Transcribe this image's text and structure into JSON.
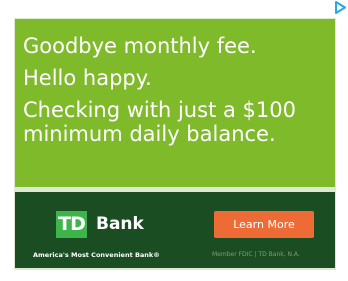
{
  "ad": {
    "headline_lines": [
      "Goodbye monthly fee.",
      "Hello happy.",
      "Checking with just a $100",
      "minimum daily balance."
    ],
    "logo_badge": "TD",
    "logo_name": "Bank",
    "tagline": "America's Most Convenient Bank®",
    "cta_label": "Learn More",
    "member_text": "Member FDIC | TD Bank, N.A.",
    "adchoices_icon": "adchoices-triangle-icon"
  },
  "colors": {
    "headline_bg": "#7fba2a",
    "footer_bg": "#1b4d23",
    "logo_green": "#3db54a",
    "cta_orange": "#ef6b36",
    "adchoices_blue": "#29a8e0"
  }
}
